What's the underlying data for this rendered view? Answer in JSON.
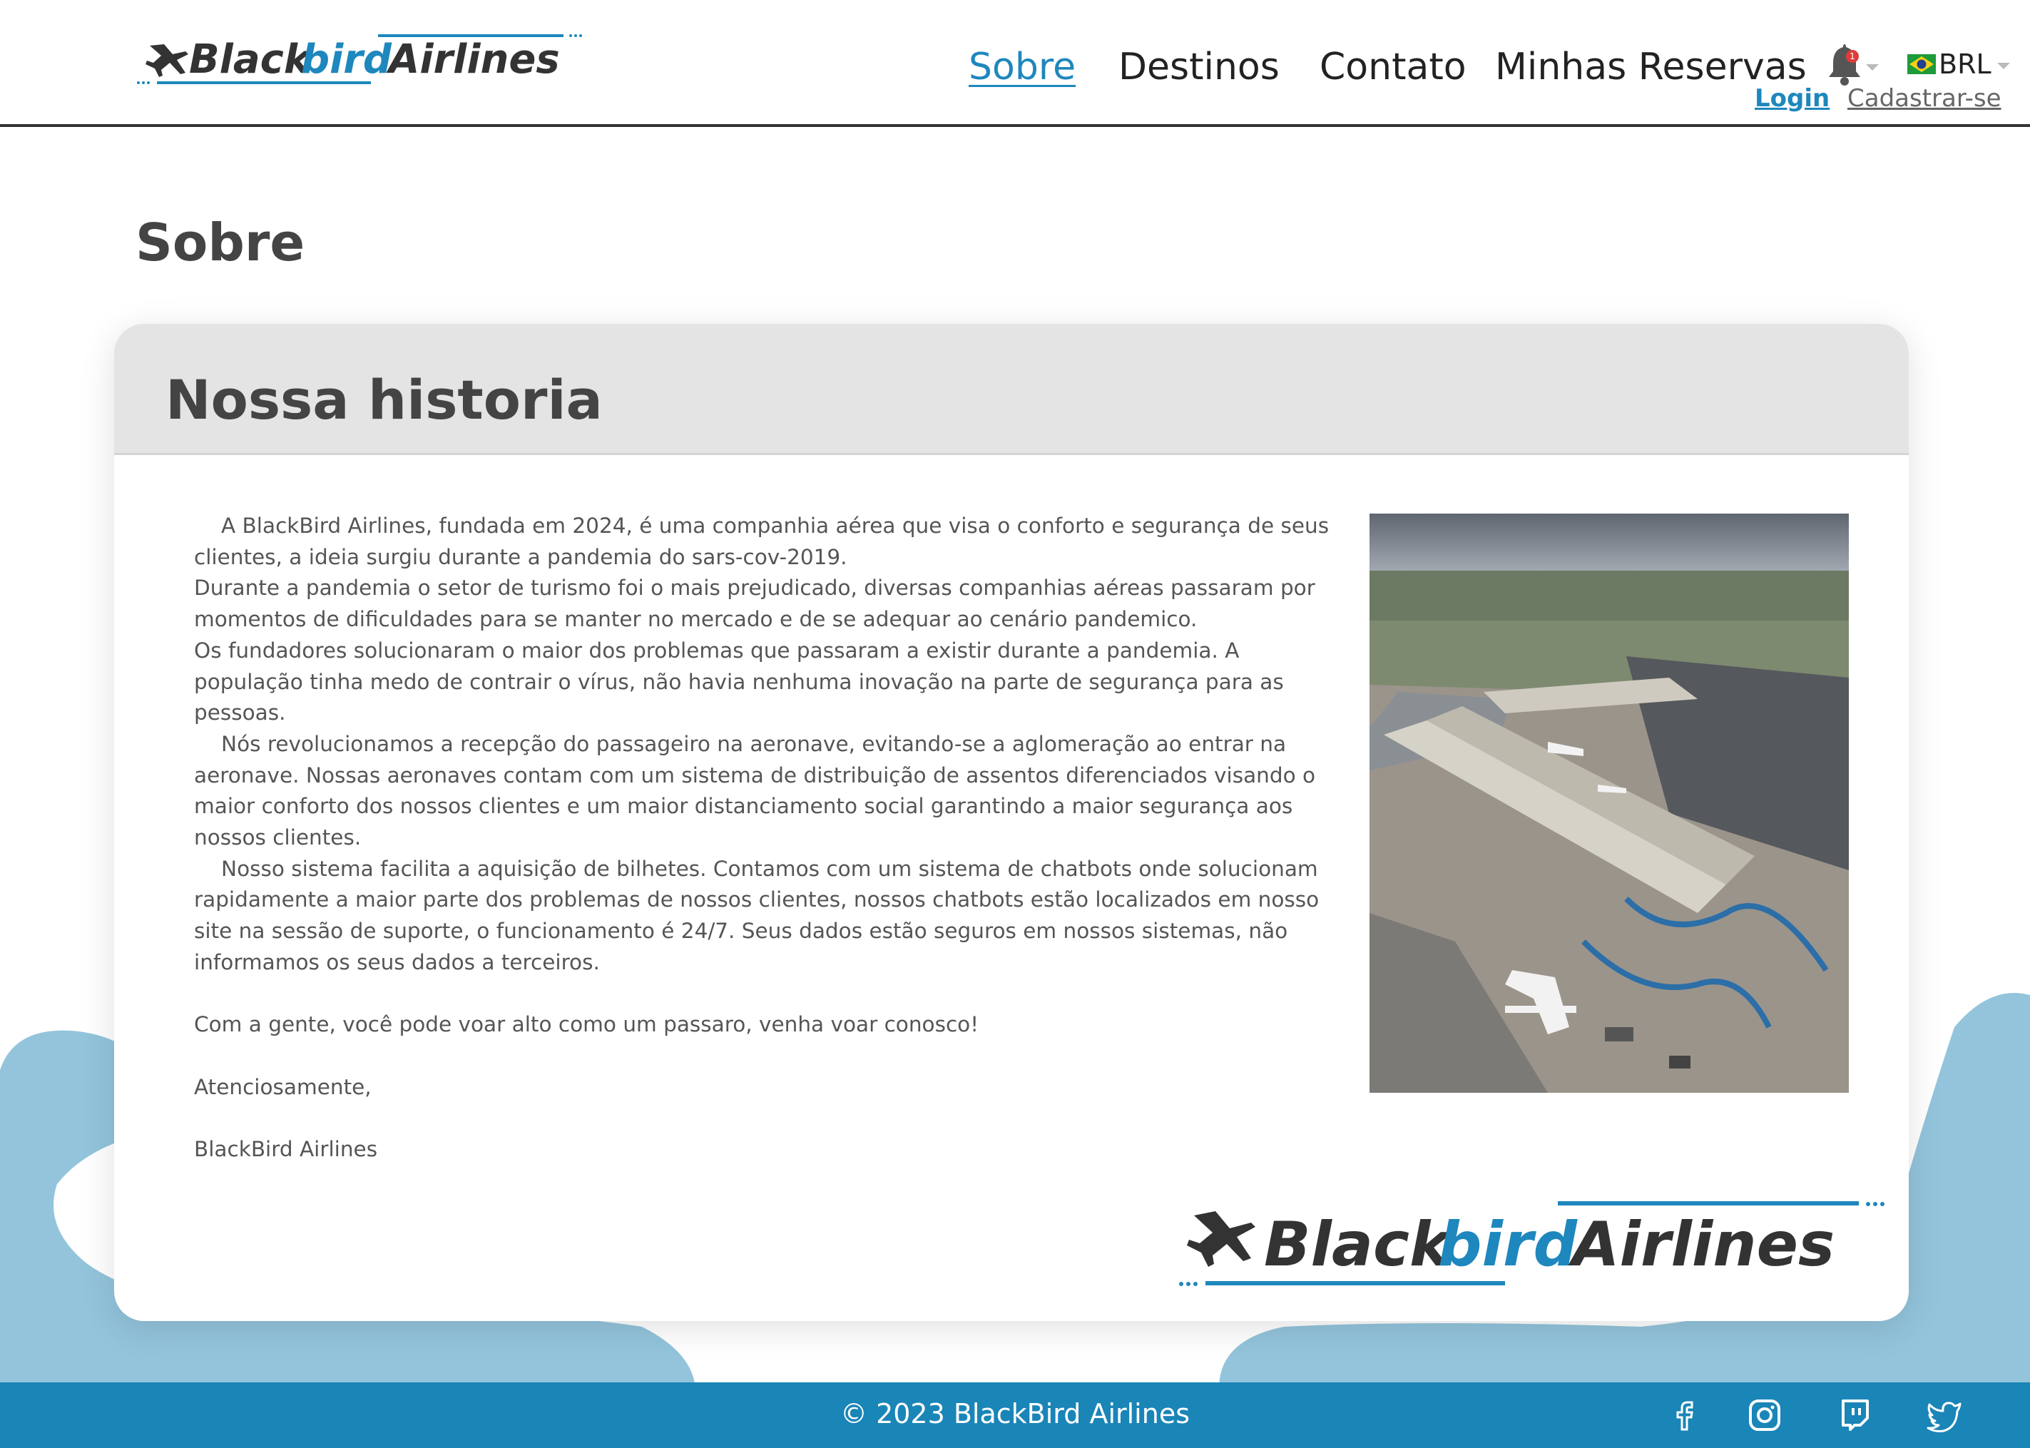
{
  "brand": {
    "word1": "Black",
    "word2": "bird",
    "word3": "Airlines",
    "colors": {
      "dark": "#333333",
      "accent": "#1e87bd"
    }
  },
  "nav": {
    "items": [
      "Sobre",
      "Destinos",
      "Contato",
      "Minhas Reservas"
    ],
    "active_index": 0
  },
  "header_right": {
    "notification_icon": "bell-icon",
    "notification_badge": "1",
    "currency_flag": "brazil-flag-icon",
    "currency": "BRL",
    "login": "Login",
    "signup": "Cadastrar-se"
  },
  "page": {
    "title": "Sobre"
  },
  "card": {
    "title": "Nossa historia",
    "paragraphs": [
      "A BlackBird Airlines, fundada em 2024, é uma companhia aérea que visa o conforto e segurança de seus clientes, a ideia surgiu durante a pandemia do sars-cov-2019.",
      "Durante a pandemia o setor de turismo foi o mais prejudicado, diversas companhias aéreas passaram por momentos de dificuldades para se manter no mercado e de se adequar ao cenário pandemico.",
      "Os fundadores solucionaram o maior dos problemas que passaram a existir durante a pandemia. A população tinha medo de contrair o vírus, não havia nenhuma inovação na parte de segurança para as pessoas.",
      "Nós revolucionamos a recepção do passageiro na aeronave, evitando-se a aglomeração ao entrar na aeronave. Nossas aeronaves contam com um sistema de distribuição de assentos diferenciados visando o maior conforto dos nossos clientes e um maior distanciamento social garantindo a maior segurança aos nossos clientes.",
      "Nosso sistema facilita a aquisição de bilhetes. Contamos com um sistema de chatbots onde solucionam rapidamente a maior parte dos problemas de nossos clientes, nossos chatbots estão localizados em nosso site na sessão de suporte, o funcionamento é 24/7. Seus dados estão seguros em nossos sistemas, não informamos os seus dados a terceiros.",
      "Com a gente, você pode voar alto como um passaro, venha voar conosco!",
      "Atenciosamente,",
      "BlackBird Airlines"
    ],
    "image": "aerial-airport-photo"
  },
  "footer": {
    "copyright": "© 2023 BlackBird Airlines",
    "social_icons": [
      "facebook-icon",
      "instagram-icon",
      "twitch-icon",
      "twitter-icon"
    ],
    "background": "#1a85b7"
  }
}
